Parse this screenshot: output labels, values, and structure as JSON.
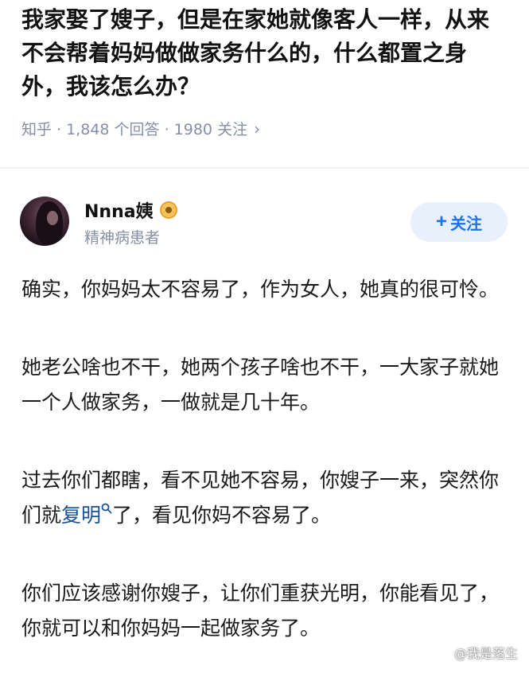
{
  "question": {
    "title": "我家娶了嫂子，但是在家她就像客人一样，从来不会帮着妈妈做做家务什么的，什么都置之身外，我该怎么办？",
    "meta": "知乎 · 1,848 个回答 · 1980 关注"
  },
  "author": {
    "name": "Nnna姨",
    "bio": "精神病患者",
    "follow_label": "关注",
    "badge_icon": "eye-badge-icon"
  },
  "answer": {
    "p1": "确实，你妈妈太不容易了，作为女人，她真的很可怜。",
    "p2": "她老公啥也不干，她两个孩子啥也不干，一大家子就她一个人做家务，一做就是几十年。",
    "p3_before": "过去你们都瞎，看不见她不容易，你嫂子一来，突然你们就",
    "p3_link": "复明",
    "p3_after": "了，看见你妈不容易了。",
    "p4": "你们应该感谢你嫂子，让你们重获光明，你能看见了，你就可以和你妈妈一起做家务了。"
  },
  "watermark": "@我是落生",
  "colors": {
    "link": "#175199",
    "follow_bg": "#e8f0fb",
    "follow_text": "#1772f6",
    "meta": "#8590a6"
  }
}
